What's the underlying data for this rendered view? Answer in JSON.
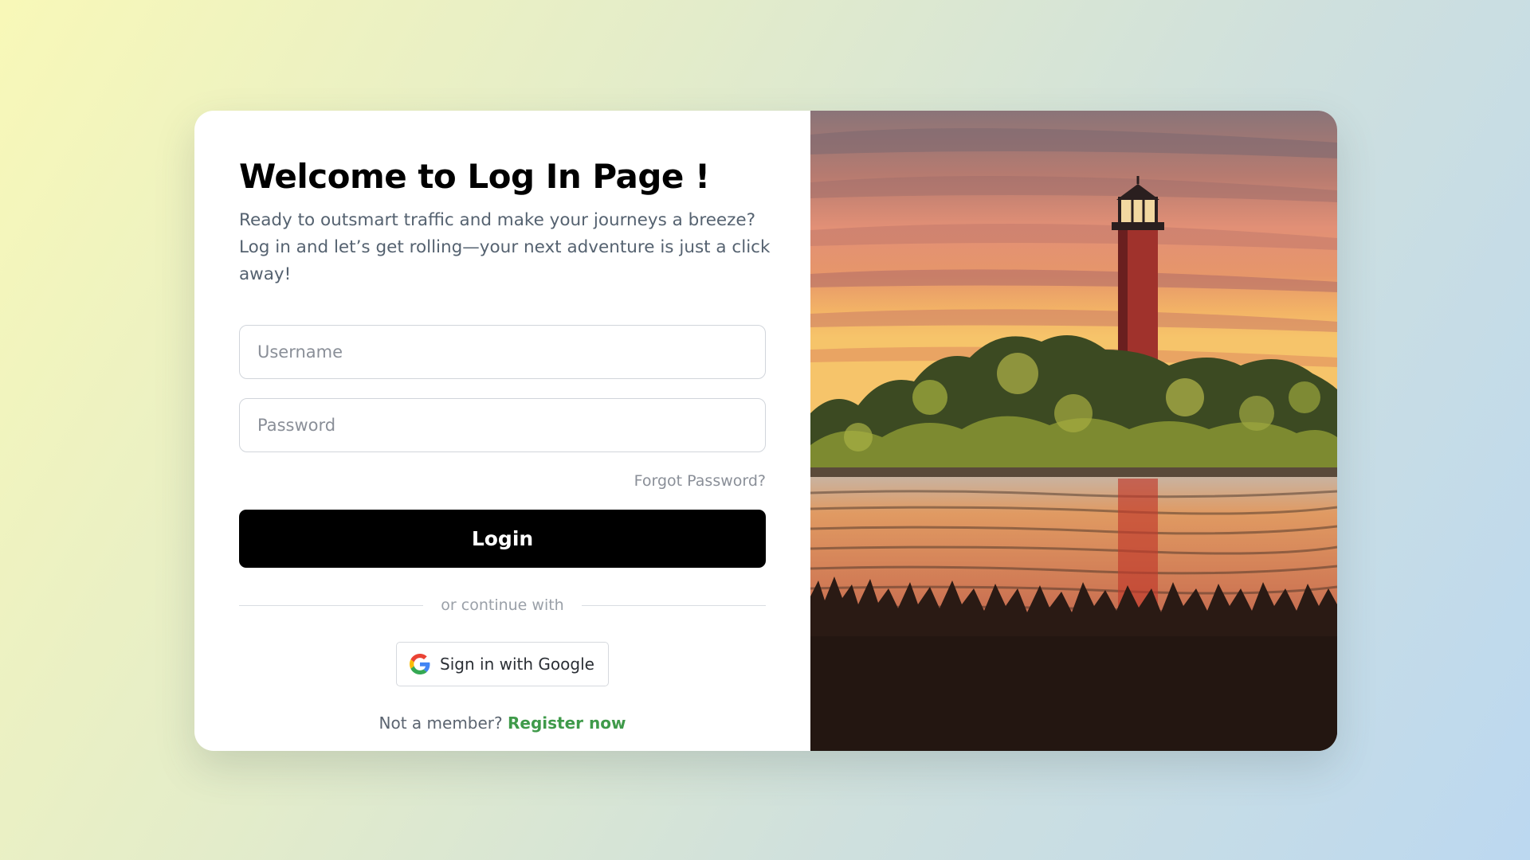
{
  "login": {
    "title": "Welcome to Log In Page !",
    "subtitle": "Ready to outsmart traffic and make your journeys a breeze? Log in and let’s get rolling—your next adventure is just a click away!",
    "username_placeholder": "Username",
    "password_placeholder": "Password",
    "forgot_password": "Forgot Password?",
    "login_button": "Login",
    "divider_text": "or continue with",
    "google_button": "Sign in with Google",
    "register_prompt": "Not a member?",
    "register_link": "Register now"
  },
  "hero_image": {
    "subject": "lighthouse-at-sunset-illustration"
  },
  "colors": {
    "primary_button": "#000000",
    "register_link": "#3f9a4a",
    "background_start": "#f8f8b8",
    "background_end": "#bcd8f0"
  }
}
